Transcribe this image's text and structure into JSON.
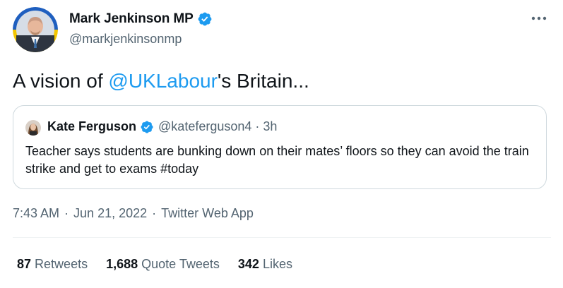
{
  "author": {
    "name": "Mark Jenkinson MP",
    "handle": "@markjenkinsonmp",
    "avatar_icon": "profile-photo-icon",
    "verified_icon": "verified-badge-icon"
  },
  "tweet": {
    "text_before": "A vision of ",
    "mention": "@UKLabour",
    "text_after": "'s Britain..."
  },
  "quote": {
    "name": "Kate Ferguson",
    "handle": "@kateferguson4",
    "separator": "·",
    "time": "3h",
    "text": "Teacher says students are bunking down on their mates’ floors so they can avoid the train strike and get to exams #today"
  },
  "meta": {
    "time": "7:43 AM",
    "separator": "·",
    "date": "Jun 21, 2022",
    "source": "Twitter Web App"
  },
  "stats": {
    "retweets_count": "87",
    "retweets_label": "Retweets",
    "quotes_count": "1,688",
    "quotes_label": "Quote Tweets",
    "likes_count": "342",
    "likes_label": "Likes"
  },
  "colors": {
    "accent": "#1d9bf0",
    "secondary_text": "#536471",
    "border": "#cfd9de",
    "ring_blue": "#1f5fbf",
    "ring_yellow": "#f2c500"
  },
  "icons": {
    "more": "more-options-icon"
  }
}
